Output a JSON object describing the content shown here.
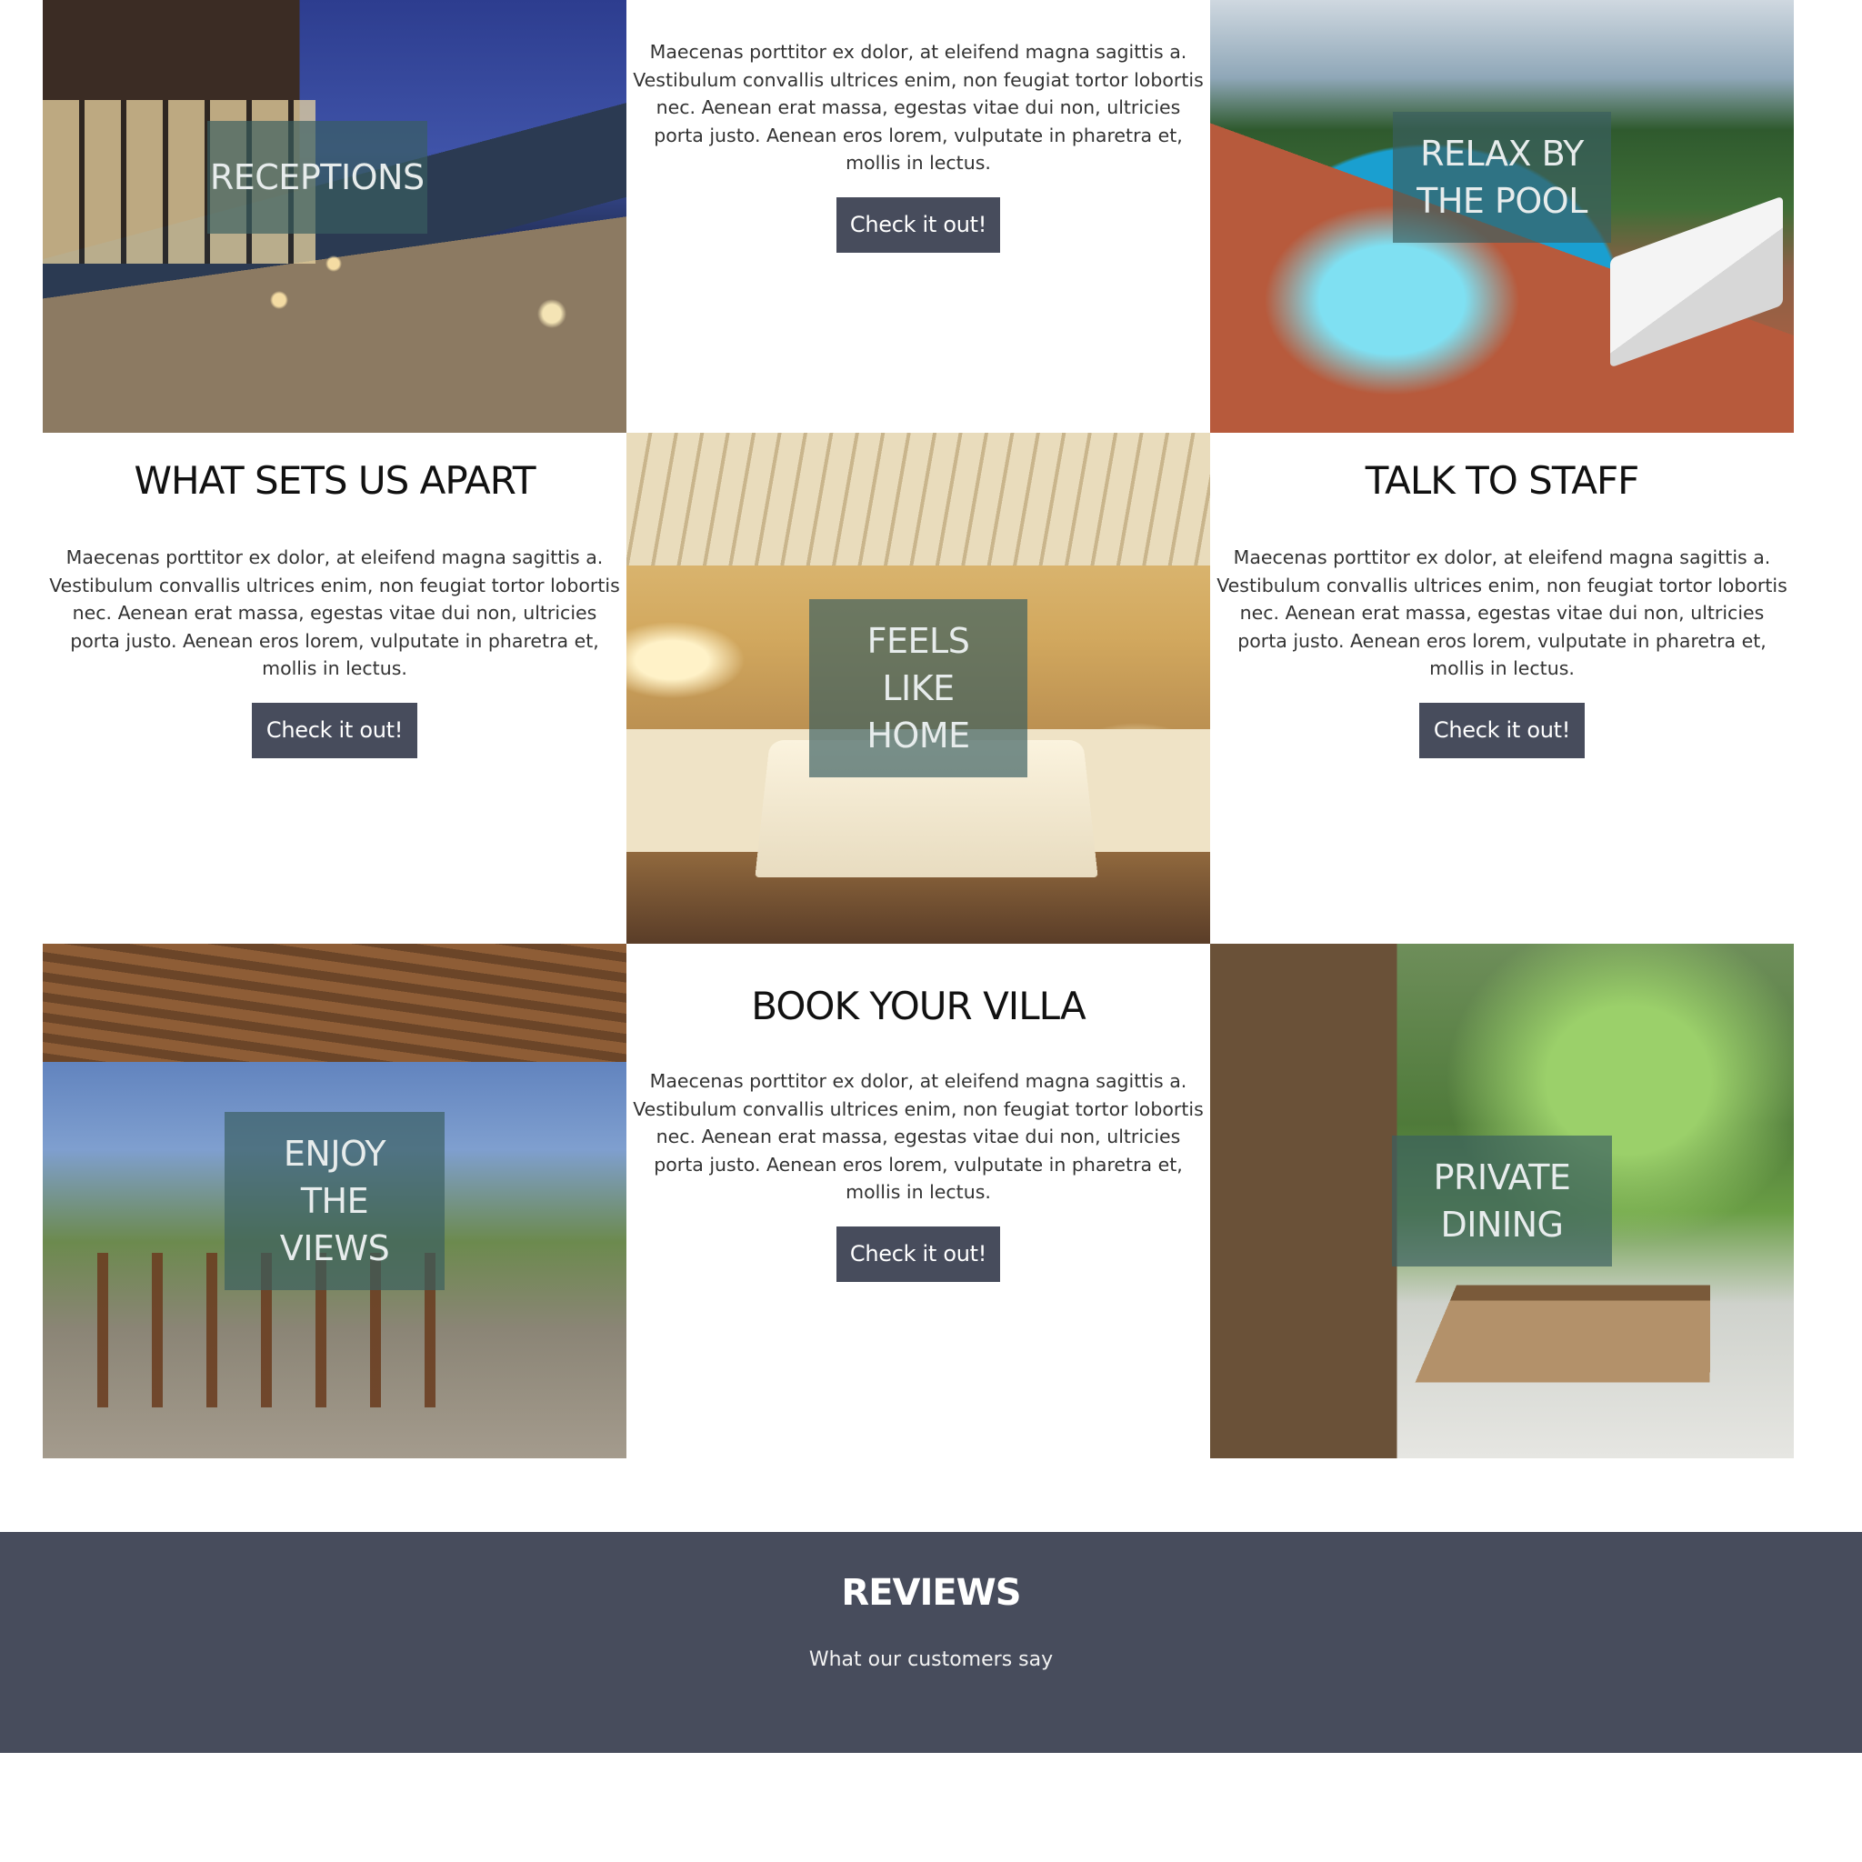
{
  "tiles": {
    "receptions": {
      "label": "RECEPTIONS"
    },
    "pool": {
      "label": "RELAX BY THE POOL"
    },
    "bedroom": {
      "label": "FEELS LIKE HOME"
    },
    "views": {
      "label": "ENJOY THE VIEWS"
    },
    "dining": {
      "label": "PRIVATE DINING"
    }
  },
  "intro": {
    "body": "Maecenas porttitor ex dolor, at eleifend magna sagittis a. Vestibulum convallis ultrices enim, non feugiat tortor lobortis nec. Aenean erat massa, egestas vitae dui non, ultricies porta justo. Aenean eros lorem, vulputate in pharetra et, mollis in lectus.",
    "button": "Check it out!"
  },
  "apart": {
    "title": "WHAT SETS US APART",
    "body": "Maecenas porttitor ex dolor, at eleifend magna sagittis a. Vestibulum convallis ultrices enim, non feugiat tortor lobortis nec. Aenean erat massa, egestas vitae dui non, ultricies porta justo. Aenean eros lorem, vulputate in pharetra et, mollis in lectus.",
    "button": "Check it out!"
  },
  "staff": {
    "title": "TALK TO STAFF",
    "body": "Maecenas porttitor ex dolor, at eleifend magna sagittis a. Vestibulum convallis ultrices enim, non feugiat tortor lobortis nec. Aenean erat massa, egestas vitae dui non, ultricies porta justo. Aenean eros lorem, vulputate in pharetra et, mollis in lectus.",
    "button": "Check it out!"
  },
  "book": {
    "title": "BOOK YOUR VILLA",
    "body": "Maecenas porttitor ex dolor, at eleifend magna sagittis a. Vestibulum convallis ultrices enim, non feugiat tortor lobortis nec. Aenean erat massa, egestas vitae dui non, ultricies porta justo. Aenean eros lorem, vulputate in pharetra et, mollis in lectus.",
    "button": "Check it out!"
  },
  "reviews": {
    "title": "REVIEWS",
    "subtitle": "What our customers say"
  },
  "colors": {
    "button_bg": "#474c5c",
    "band_bg": "#474c5c",
    "overlay_bg": "#3a5e60"
  }
}
